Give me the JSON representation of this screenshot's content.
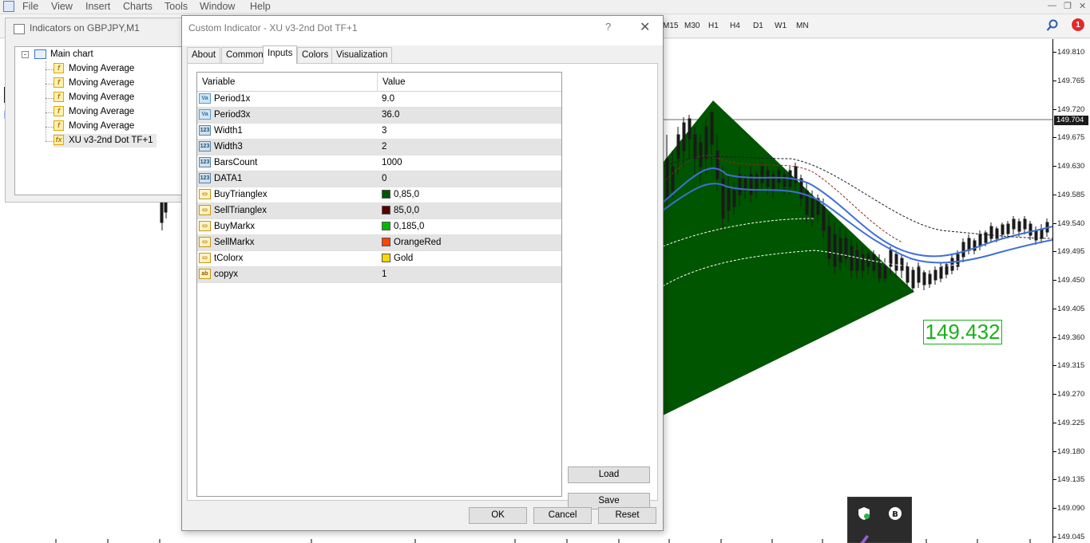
{
  "menu": [
    "File",
    "View",
    "Insert",
    "Charts",
    "Tools",
    "Window",
    "Help"
  ],
  "timeframes": [
    "M15",
    "M30",
    "H1",
    "H4",
    "D1",
    "W1",
    "MN"
  ],
  "notification_count": "1",
  "indicators_window": {
    "title": "Indicators on GBPJPY,M1",
    "tree_root": "Main chart",
    "items": [
      "Moving Average",
      "Moving Average",
      "Moving Average",
      "Moving Average",
      "Moving Average",
      "XU v3-2nd Dot TF+1"
    ]
  },
  "dialog": {
    "title": "Custom Indicator - XU v3-2nd Dot TF+1",
    "help": "?",
    "tabs": [
      "About",
      "Common",
      "Inputs",
      "Colors",
      "Visualization"
    ],
    "active_tab": "Inputs",
    "columns": [
      "Variable",
      "Value"
    ],
    "rows": [
      {
        "type": "double",
        "icon": "Va",
        "name": "Period1x",
        "value": "9.0"
      },
      {
        "type": "double",
        "icon": "Va",
        "name": "Period3x",
        "value": "36.0"
      },
      {
        "type": "int",
        "icon": "123",
        "name": "Width1",
        "value": "3"
      },
      {
        "type": "int",
        "icon": "123",
        "name": "Width3",
        "value": "2"
      },
      {
        "type": "int",
        "icon": "123",
        "name": "BarsCount",
        "value": "1000"
      },
      {
        "type": "int",
        "icon": "123",
        "name": "DATA1",
        "value": "0"
      },
      {
        "type": "color",
        "icon": "",
        "name": "BuyTrianglex",
        "value": "0,85,0",
        "swatch": "#005500"
      },
      {
        "type": "color",
        "icon": "",
        "name": "SellTrianglex",
        "value": "85,0,0",
        "swatch": "#550000"
      },
      {
        "type": "color",
        "icon": "",
        "name": "BuyMarkx",
        "value": "0,185,0",
        "swatch": "#00b900"
      },
      {
        "type": "color",
        "icon": "",
        "name": "SellMarkx",
        "value": "OrangeRed",
        "swatch": "#ff4500"
      },
      {
        "type": "color",
        "icon": "",
        "name": "tColorx",
        "value": "Gold",
        "swatch": "#ffd700"
      },
      {
        "type": "string",
        "icon": "ab",
        "name": "copyx",
        "value": "1"
      }
    ],
    "buttons": {
      "load": "Load",
      "save": "Save",
      "ok": "OK",
      "cancel": "Cancel",
      "reset": "Reset"
    }
  },
  "price_axis": [
    "149.810",
    "149.765",
    "149.720",
    "149.675",
    "149.630",
    "149.585",
    "149.540",
    "149.495",
    "149.450",
    "149.405",
    "149.360",
    "149.315",
    "149.270",
    "149.225",
    "149.180",
    "149.135",
    "149.090",
    "149.045"
  ],
  "current_price": "149.704",
  "big_price_label": "149.432",
  "colors": {
    "triangle": "#005500",
    "ma_blue": "#3f6fd8",
    "candle": "#1a1a1a",
    "arrow": "#e8141b",
    "price_green": "#19b119"
  }
}
